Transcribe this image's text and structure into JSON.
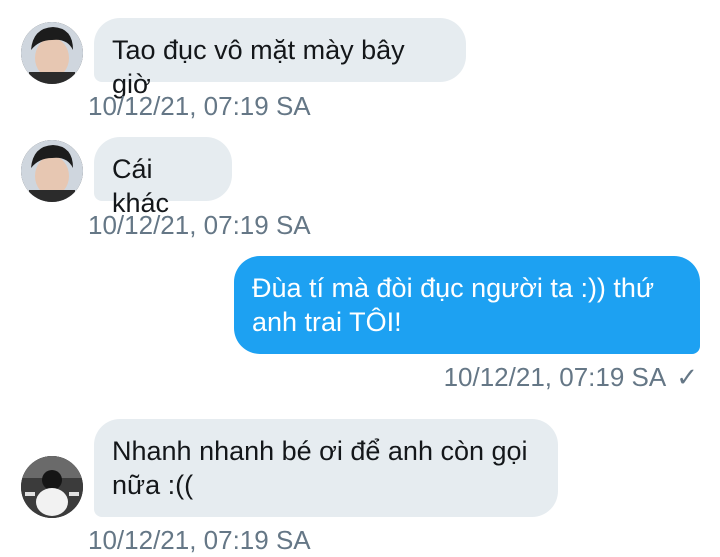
{
  "messages": [
    {
      "direction": "incoming",
      "avatar": "avatar-young-man-dark-hair",
      "text": "Tao đục vô mặt mày bây giờ",
      "timestamp": "10/12/21, 07:19 SA"
    },
    {
      "direction": "incoming",
      "avatar": "avatar-young-man-dark-hair",
      "text": "Cái khác",
      "timestamp": "10/12/21, 07:19 SA"
    },
    {
      "direction": "outgoing",
      "text_line1": "Đùa tí mà đòi đục người ta :)) thứ",
      "text_line2": "anh trai TÔI!",
      "timestamp": "10/12/21, 07:19 SA",
      "status_icon": "checkmark-icon",
      "status_glyph": "✓"
    },
    {
      "direction": "incoming",
      "avatar": "avatar-person-white-shirt",
      "text_line1": "Nhanh nhanh bé ơi để anh còn gọi",
      "text_line2": "nữa :((",
      "timestamp": "10/12/21, 07:19 SA"
    }
  ],
  "colors": {
    "incoming_bubble": "#e6ecf0",
    "outgoing_bubble": "#1da1f2",
    "timestamp_text": "#657786"
  }
}
